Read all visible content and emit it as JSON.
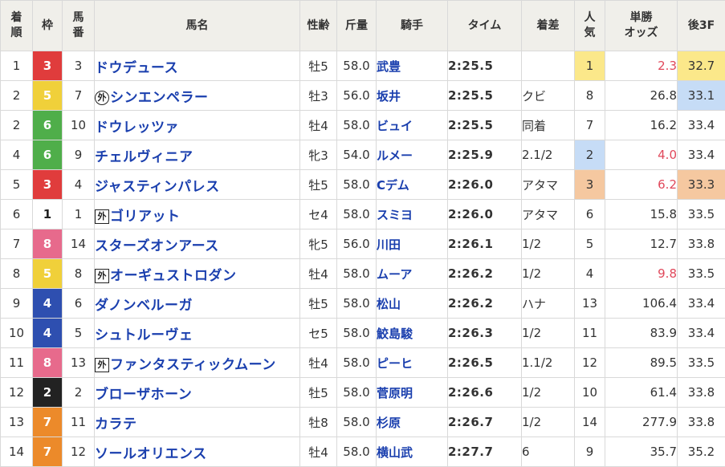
{
  "headers": {
    "rank": "着\n順",
    "waku": "枠",
    "num": "馬\n番",
    "horse": "馬名",
    "sexage": "性齢",
    "weight": "斤量",
    "jockey": "騎手",
    "time": "タイム",
    "margin": "着差",
    "pop": "人\n気",
    "odds": "単勝\nオッズ",
    "last3f": "後3F"
  },
  "colors": {
    "waku": {
      "1": "#ffffff",
      "2": "#222222",
      "3": "#e03c3c",
      "4": "#2e4fb0",
      "5": "#f0d03a",
      "6": "#4fae4a",
      "7": "#ec8a2a",
      "8": "#e76a8c"
    },
    "highlight_gold": "#fbe88a",
    "highlight_blue": "#c6dcf6",
    "highlight_orange": "#f5c8a0"
  },
  "rows": [
    {
      "rank": "1",
      "waku": "3",
      "num": "3",
      "mark": "",
      "name": "ドウデュース",
      "sexage": "牡5",
      "weight": "58.0",
      "jockey": "武豊",
      "time": "2:25.5",
      "margin": "",
      "pop": "1",
      "odds": "2.3",
      "last3f": "32.7"
    },
    {
      "rank": "2",
      "waku": "5",
      "num": "7",
      "mark": "外",
      "name": "シンエンペラー",
      "sexage": "牡3",
      "weight": "56.0",
      "jockey": "坂井",
      "time": "2:25.5",
      "margin": "クビ",
      "pop": "8",
      "odds": "26.8",
      "last3f": "33.1"
    },
    {
      "rank": "2",
      "waku": "6",
      "num": "10",
      "mark": "",
      "name": "ドウレッツァ",
      "sexage": "牡4",
      "weight": "58.0",
      "jockey": "ビュイ",
      "time": "2:25.5",
      "margin": "同着",
      "pop": "7",
      "odds": "16.2",
      "last3f": "33.4"
    },
    {
      "rank": "4",
      "waku": "6",
      "num": "9",
      "mark": "",
      "name": "チェルヴィニア",
      "sexage": "牝3",
      "weight": "54.0",
      "jockey": "ルメー",
      "time": "2:25.9",
      "margin": "2.1/2",
      "pop": "2",
      "odds": "4.0",
      "last3f": "33.4"
    },
    {
      "rank": "5",
      "waku": "3",
      "num": "4",
      "mark": "",
      "name": "ジャスティンパレス",
      "sexage": "牡5",
      "weight": "58.0",
      "jockey": "Cデム",
      "time": "2:26.0",
      "margin": "アタマ",
      "pop": "3",
      "odds": "6.2",
      "last3f": "33.3"
    },
    {
      "rank": "6",
      "waku": "1",
      "num": "1",
      "mark": "外",
      "name": "ゴリアット",
      "sexage": "セ4",
      "weight": "58.0",
      "jockey": "スミヨ",
      "time": "2:26.0",
      "margin": "アタマ",
      "pop": "6",
      "odds": "15.8",
      "last3f": "33.5"
    },
    {
      "rank": "7",
      "waku": "8",
      "num": "14",
      "mark": "",
      "name": "スターズオンアース",
      "sexage": "牝5",
      "weight": "56.0",
      "jockey": "川田",
      "time": "2:26.1",
      "margin": "1/2",
      "pop": "5",
      "odds": "12.7",
      "last3f": "33.8"
    },
    {
      "rank": "8",
      "waku": "5",
      "num": "8",
      "mark": "外",
      "name": "オーギュストロダン",
      "sexage": "牡4",
      "weight": "58.0",
      "jockey": "ムーア",
      "time": "2:26.2",
      "margin": "1/2",
      "pop": "4",
      "odds": "9.8",
      "last3f": "33.5"
    },
    {
      "rank": "9",
      "waku": "4",
      "num": "6",
      "mark": "",
      "name": "ダノンベルーガ",
      "sexage": "牡5",
      "weight": "58.0",
      "jockey": "松山",
      "time": "2:26.2",
      "margin": "ハナ",
      "pop": "13",
      "odds": "106.4",
      "last3f": "33.4"
    },
    {
      "rank": "10",
      "waku": "4",
      "num": "5",
      "mark": "",
      "name": "シュトルーヴェ",
      "sexage": "セ5",
      "weight": "58.0",
      "jockey": "鮫島駿",
      "time": "2:26.3",
      "margin": "1/2",
      "pop": "11",
      "odds": "83.9",
      "last3f": "33.4"
    },
    {
      "rank": "11",
      "waku": "8",
      "num": "13",
      "mark": "外",
      "name": "ファンタスティックムーン",
      "sexage": "牡4",
      "weight": "58.0",
      "jockey": "ピーヒ",
      "time": "2:26.5",
      "margin": "1.1/2",
      "pop": "12",
      "odds": "89.5",
      "last3f": "33.5"
    },
    {
      "rank": "12",
      "waku": "2",
      "num": "2",
      "mark": "",
      "name": "ブローザホーン",
      "sexage": "牡5",
      "weight": "58.0",
      "jockey": "菅原明",
      "time": "2:26.6",
      "margin": "1/2",
      "pop": "10",
      "odds": "61.4",
      "last3f": "33.8"
    },
    {
      "rank": "13",
      "waku": "7",
      "num": "11",
      "mark": "",
      "name": "カラテ",
      "sexage": "牡8",
      "weight": "58.0",
      "jockey": "杉原",
      "time": "2:26.7",
      "margin": "1/2",
      "pop": "14",
      "odds": "277.9",
      "last3f": "33.8"
    },
    {
      "rank": "14",
      "waku": "7",
      "num": "12",
      "mark": "",
      "name": "ソールオリエンス",
      "sexage": "牡4",
      "weight": "58.0",
      "jockey": "横山武",
      "time": "2:27.7",
      "margin": "6",
      "pop": "9",
      "odds": "35.7",
      "last3f": "35.2"
    }
  ]
}
